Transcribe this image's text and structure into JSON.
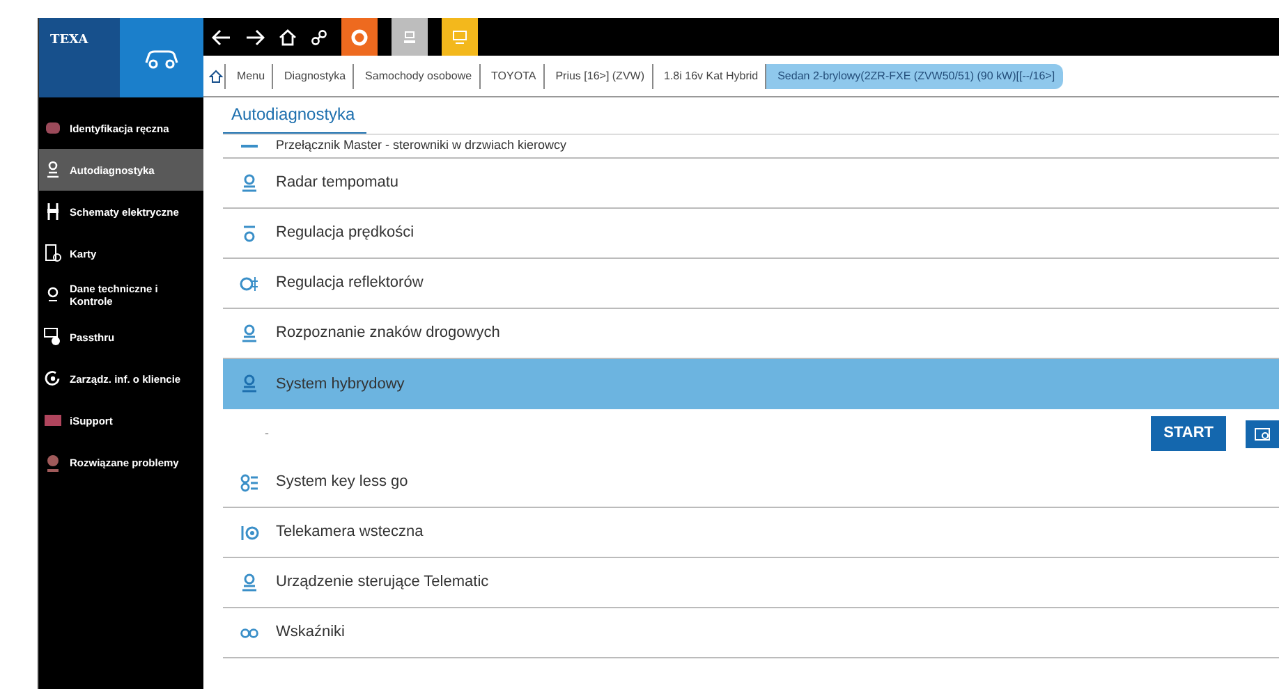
{
  "brand": {
    "logo": "TEXA"
  },
  "breadcrumb": [
    {
      "label": "Menu",
      "selected": false
    },
    {
      "label": "Diagnostyka",
      "selected": false
    },
    {
      "label": "Samochody osobowe",
      "selected": false
    },
    {
      "label": "TOYOTA",
      "selected": false
    },
    {
      "label": "Prius [16>] (ZVW)",
      "selected": false
    },
    {
      "label": "1.8i 16v Kat Hybrid",
      "selected": false
    },
    {
      "label": "Sedan 2-brylowy(2ZR-FXE (ZVW50/51) (90 kW)[[--/16>]",
      "selected": true
    }
  ],
  "sidebar": {
    "items": [
      {
        "label": "Identyfikacja ręczna",
        "selected": false
      },
      {
        "label": "Autodiagnostyka",
        "selected": true
      },
      {
        "label": "Schematy elektryczne",
        "selected": false
      },
      {
        "label": "Karty",
        "selected": false
      },
      {
        "label": "Dane techniczne i Kontrole",
        "selected": false
      },
      {
        "label": "Passthru",
        "selected": false
      },
      {
        "label": "Zarządz. inf. o kliencie",
        "selected": false
      },
      {
        "label": "iSupport",
        "selected": false
      },
      {
        "label": "Rozwiązane problemy",
        "selected": false
      }
    ]
  },
  "panel": {
    "tab": "Autodiagnostyka",
    "rows": [
      {
        "kind": "item",
        "label": "Przełącznik Master - sterowniki w drzwiach kierowcy",
        "selected": false
      },
      {
        "kind": "item",
        "label": "Radar tempomatu",
        "selected": false
      },
      {
        "kind": "item",
        "label": "Regulacja prędkości",
        "selected": false
      },
      {
        "kind": "item",
        "label": "Regulacja reflektorów",
        "selected": false
      },
      {
        "kind": "item",
        "label": "Rozpoznanie znaków drogowych",
        "selected": false
      },
      {
        "kind": "item",
        "label": "System hybrydowy",
        "selected": true
      },
      {
        "kind": "detail",
        "label": "-",
        "button": "START"
      },
      {
        "kind": "item",
        "label": "System key less go",
        "selected": false
      },
      {
        "kind": "item",
        "label": "Telekamera wsteczna",
        "selected": false
      },
      {
        "kind": "item",
        "label": "Urządzenie sterujące Telematic",
        "selected": false
      },
      {
        "kind": "item",
        "label": "Wskaźniki",
        "selected": false
      }
    ]
  }
}
